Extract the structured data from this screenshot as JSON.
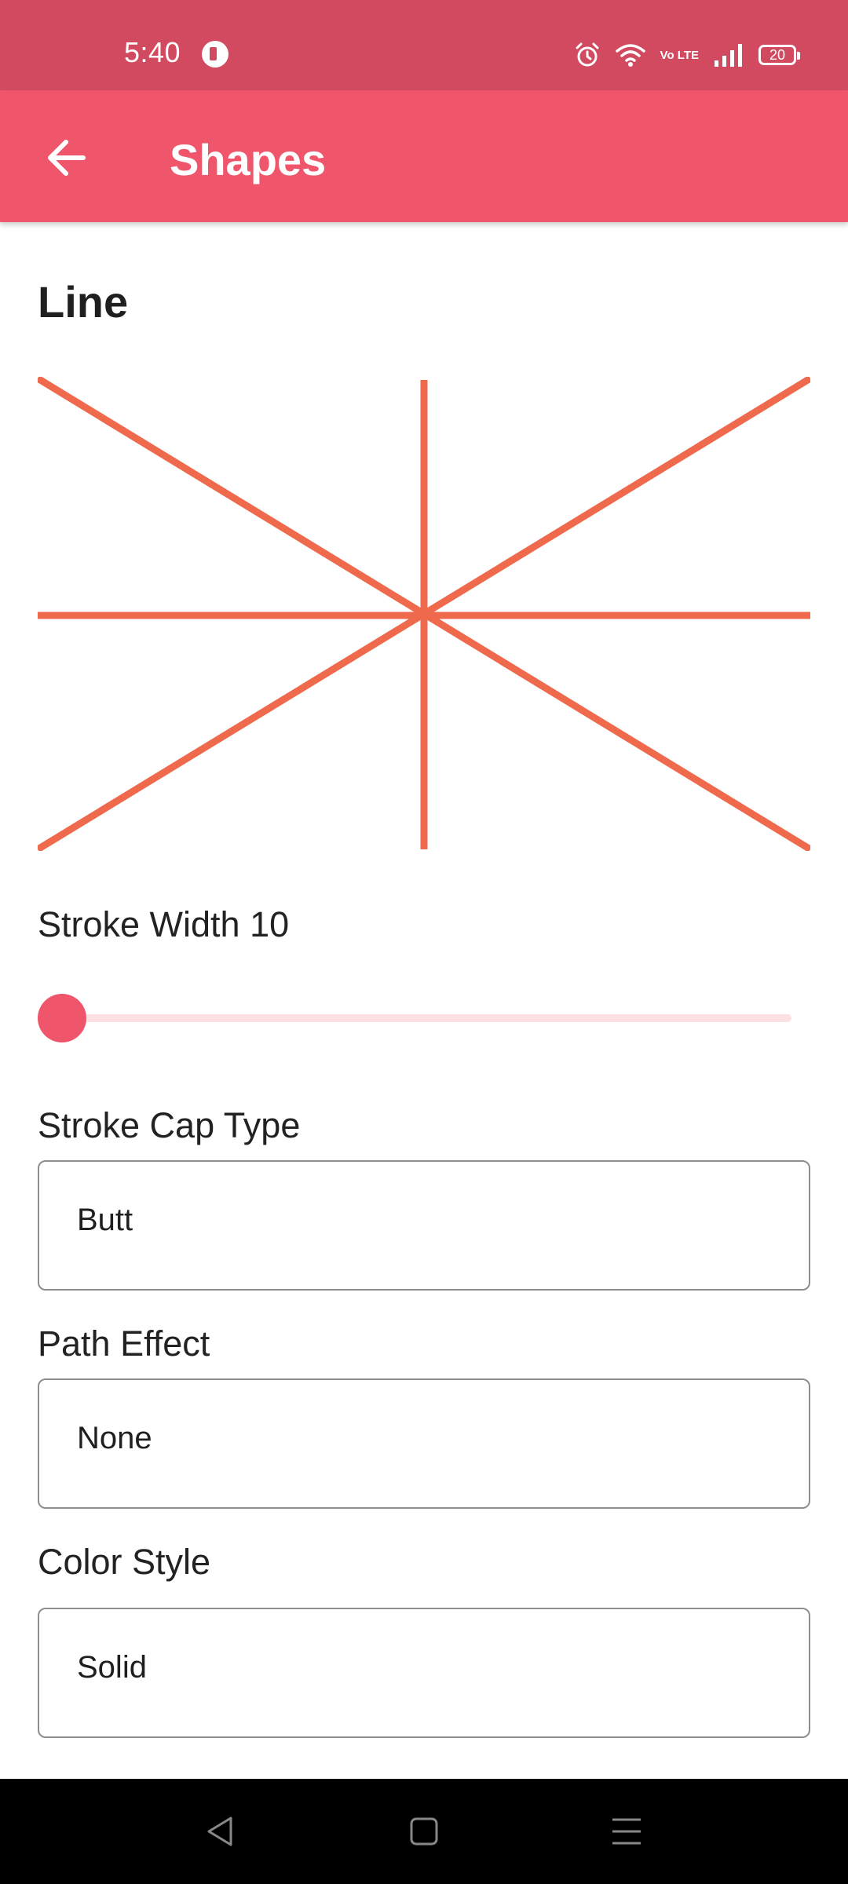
{
  "status_bar": {
    "time": "5:40",
    "battery": "20",
    "network_label": "Vo LTE",
    "icons": [
      "app-notification-icon",
      "alarm-icon",
      "wifi-icon",
      "volte-icon",
      "signal-icon",
      "battery-icon"
    ]
  },
  "app_bar": {
    "title": "Shapes",
    "back_icon": "arrow-left-icon",
    "color": "#f0566b"
  },
  "content": {
    "section_title": "Line",
    "stroke_color": "#ef6a4c",
    "stroke_width": {
      "label": "Stroke Width 10",
      "value": 10,
      "slider_fraction": 0.0
    },
    "stroke_cap": {
      "label": "Stroke Cap Type",
      "selected": "Butt"
    },
    "path_effect": {
      "label": "Path Effect",
      "selected": "None"
    },
    "color_style": {
      "label": "Color Style",
      "selected": "Solid"
    }
  },
  "nav_bar": {
    "icons": [
      "back-triangle-icon",
      "home-square-icon",
      "menu-lines-icon"
    ]
  }
}
